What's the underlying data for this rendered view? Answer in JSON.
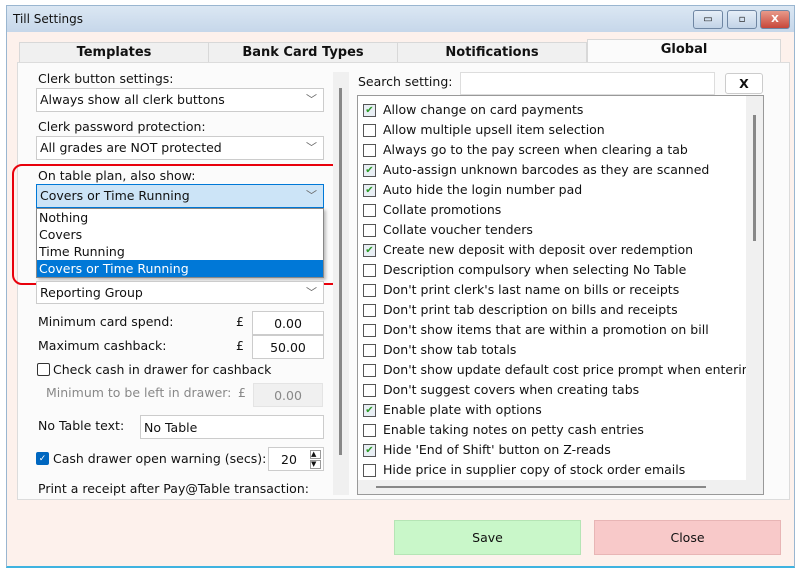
{
  "window": {
    "title": "Till Settings",
    "minimize": "▭",
    "restore": "▫",
    "close": "X"
  },
  "tabs": [
    {
      "label": "Templates"
    },
    {
      "label": "Bank Card Types"
    },
    {
      "label": "Notifications"
    },
    {
      "label": "Global",
      "active": true
    }
  ],
  "left": {
    "clerk_button_label": "Clerk button settings:",
    "clerk_button_value": "Always show all clerk buttons",
    "clerk_password_label": "Clerk password protection:",
    "clerk_password_value": "All grades are NOT protected",
    "table_plan_label": "On table plan, also show:",
    "table_plan_value": "Covers or Time Running",
    "table_plan_options": [
      "Nothing",
      "Covers",
      "Time Running",
      "Covers or Time Running"
    ],
    "reporting_value": "Reporting Group",
    "min_card_label": "Minimum card spend:",
    "currency": "£",
    "min_card_value": "0.00",
    "max_cashback_label": "Maximum cashback:",
    "max_cashback_value": "50.00",
    "check_cash_label": "Check cash in drawer for cashback",
    "check_cash_checked": false,
    "min_left_label": "Minimum to be left in drawer:",
    "min_left_value": "0.00",
    "no_table_label": "No Table text:",
    "no_table_value": "No Table",
    "drawer_warning_label": "Cash drawer open warning (secs):",
    "drawer_warning_checked": true,
    "drawer_warning_value": "20",
    "print_receipt_label": "Print a receipt after Pay@Table transaction:"
  },
  "right": {
    "search_label": "Search setting:",
    "search_value": "",
    "clear_label": "X",
    "settings": [
      {
        "label": "Allow change on card payments",
        "checked": true
      },
      {
        "label": "Allow multiple upsell item selection",
        "checked": false
      },
      {
        "label": "Always go to the pay screen when clearing a tab",
        "checked": false
      },
      {
        "label": "Auto-assign unknown barcodes as they are scanned",
        "checked": true
      },
      {
        "label": "Auto hide the login number pad",
        "checked": true
      },
      {
        "label": "Collate promotions",
        "checked": false
      },
      {
        "label": "Collate voucher tenders",
        "checked": false
      },
      {
        "label": "Create new deposit with deposit over redemption",
        "checked": true
      },
      {
        "label": "Description compulsory when selecting No Table",
        "checked": false
      },
      {
        "label": "Don't print clerk's last name on bills or receipts",
        "checked": false
      },
      {
        "label": "Don't print tab description on bills and receipts",
        "checked": false
      },
      {
        "label": "Don't show items that are within a promotion on bill",
        "checked": false
      },
      {
        "label": "Don't show tab totals",
        "checked": false
      },
      {
        "label": "Don't show update default cost price prompt when entering de",
        "checked": false
      },
      {
        "label": "Don't suggest covers when creating tabs",
        "checked": false
      },
      {
        "label": "Enable plate with options",
        "checked": true
      },
      {
        "label": "Enable taking notes on petty cash entries",
        "checked": false
      },
      {
        "label": "Hide 'End of Shift' button on Z-reads",
        "checked": true
      },
      {
        "label": "Hide price in supplier copy of stock order emails",
        "checked": false
      }
    ]
  },
  "footer": {
    "save": "Save",
    "close": "Close"
  },
  "colors": {
    "save_bg": "#c9f7c9",
    "close_bg": "#f8c9c9",
    "highlight": "#e8000b",
    "selection": "#0078d7"
  }
}
